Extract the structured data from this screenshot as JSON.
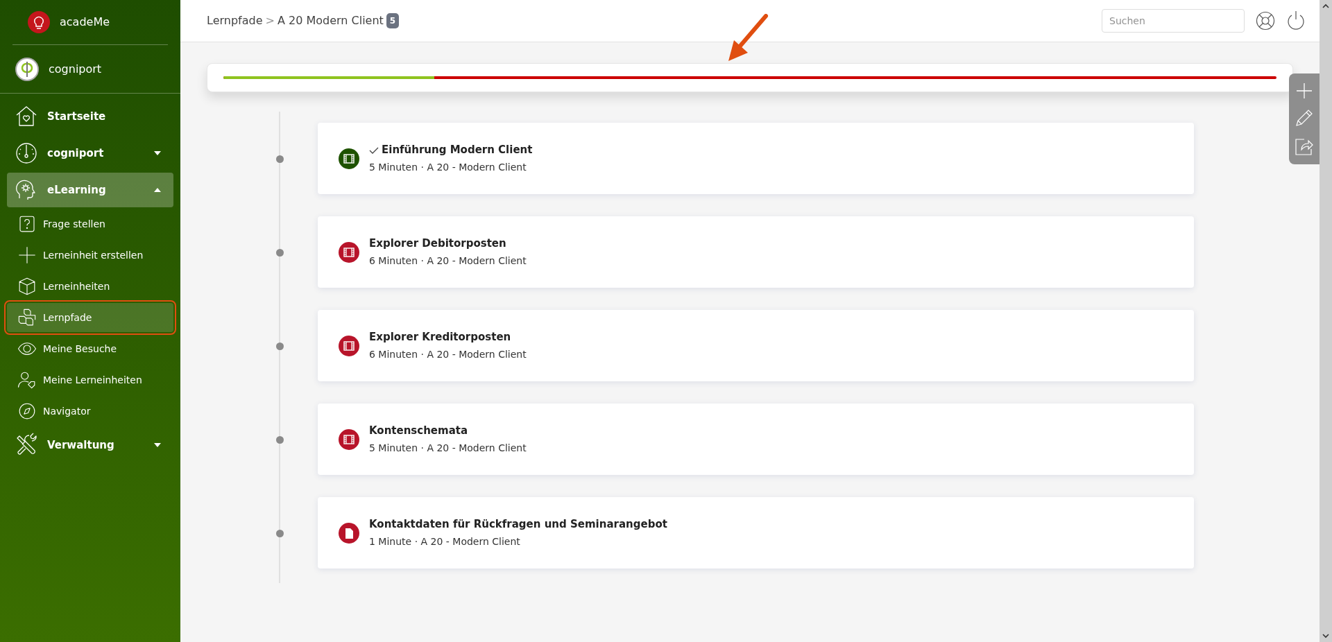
{
  "apps": [
    {
      "label": "acadeMe"
    },
    {
      "label": "cogniport"
    }
  ],
  "nav": [
    {
      "label": "Startseite",
      "kind": "main",
      "selected": false
    },
    {
      "label": "cogniport",
      "kind": "main",
      "selected": false,
      "expanded": false
    },
    {
      "label": "eLearning",
      "kind": "main",
      "selected": true,
      "expanded": true
    },
    {
      "label": "Frage stellen",
      "kind": "sub",
      "selected": false
    },
    {
      "label": "Lerneinheit erstellen",
      "kind": "sub",
      "selected": false
    },
    {
      "label": "Lerneinheiten",
      "kind": "sub",
      "selected": false
    },
    {
      "label": "Lernpfade",
      "kind": "sub",
      "selected": true
    },
    {
      "label": "Meine Besuche",
      "kind": "sub",
      "selected": false
    },
    {
      "label": "Meine Lerneinheiten",
      "kind": "sub",
      "selected": false
    },
    {
      "label": "Navigator",
      "kind": "sub",
      "selected": false
    },
    {
      "label": "Verwaltung",
      "kind": "main",
      "selected": false,
      "expanded": false
    }
  ],
  "breadcrumb": {
    "parent": "Lernpfade",
    "separator": ">",
    "current": "A 20 Modern Client",
    "count": "5"
  },
  "search": {
    "placeholder": "Suchen"
  },
  "progress": {
    "level": 0.2
  },
  "lessons": [
    {
      "title": "Einführung Modern Client",
      "meta": "5 Minuten · A 20 - Modern Client",
      "kind": "video",
      "completed": true
    },
    {
      "title": "Explorer Debitorposten",
      "meta": "6 Minuten · A 20 - Modern Client",
      "kind": "video",
      "completed": false
    },
    {
      "title": "Explorer Kreditorposten",
      "meta": "6 Minuten · A 20 - Modern Client",
      "kind": "video",
      "completed": false
    },
    {
      "title": "Kontenschemata",
      "meta": "5 Minuten · A 20 - Modern Client",
      "kind": "video",
      "completed": false
    },
    {
      "title": "Kontaktdaten für Rückfragen und Seminarangebot",
      "meta": "1 Minute · A 20 - Modern Client",
      "kind": "document",
      "completed": false
    }
  ]
}
